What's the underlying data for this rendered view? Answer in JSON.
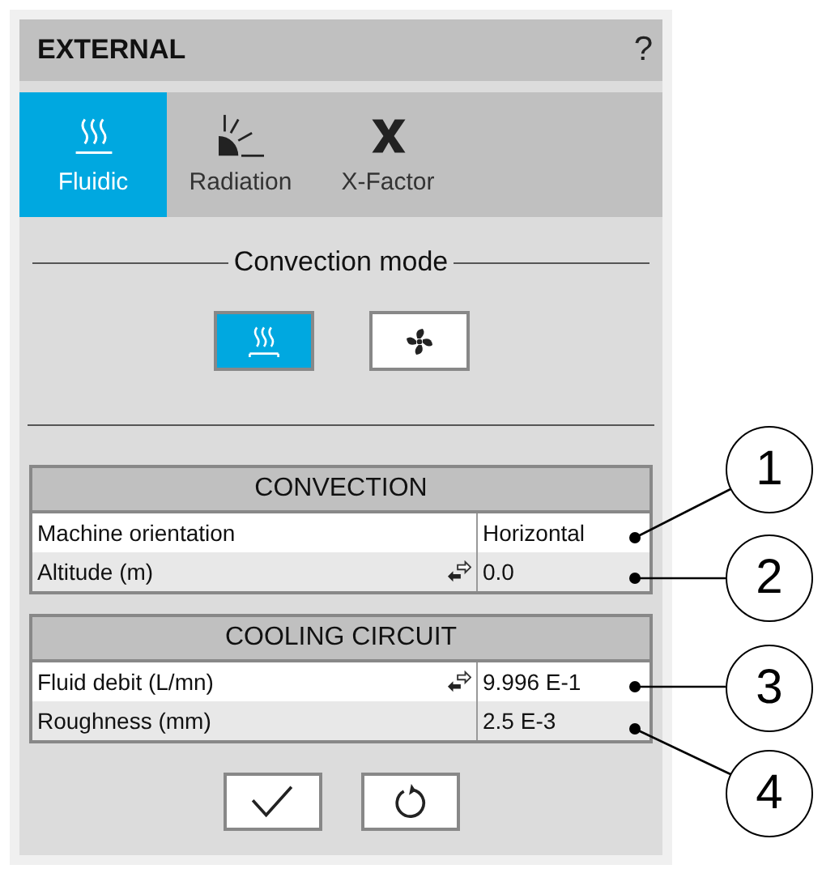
{
  "panel": {
    "title": "EXTERNAL",
    "help": "?"
  },
  "tabs": [
    {
      "label": "Fluidic",
      "kind": "heat",
      "selected": true
    },
    {
      "label": "Radiation",
      "kind": "radiation",
      "selected": false
    },
    {
      "label": "X-Factor",
      "kind": "xfactor",
      "selected": false
    }
  ],
  "convection_mode": {
    "title": "Convection mode",
    "options": [
      {
        "kind": "natural",
        "selected": true
      },
      {
        "kind": "forced",
        "selected": false
      }
    ]
  },
  "tables": [
    {
      "title": "CONVECTION",
      "rows": [
        {
          "label": "Machine orientation",
          "value": "Horizontal",
          "linked": false,
          "callout": "1"
        },
        {
          "label": "Altitude (m)",
          "value": "0.0",
          "linked": true,
          "callout": "2"
        }
      ]
    },
    {
      "title": "COOLING CIRCUIT",
      "rows": [
        {
          "label": "Fluid debit (L/mn)",
          "value": "9.996 E-1",
          "linked": true,
          "callout": "3"
        },
        {
          "label": "Roughness (mm)",
          "value": "2.5 E-3",
          "linked": false,
          "callout": "4"
        }
      ]
    }
  ],
  "actions": [
    {
      "kind": "apply"
    },
    {
      "kind": "reset"
    }
  ]
}
